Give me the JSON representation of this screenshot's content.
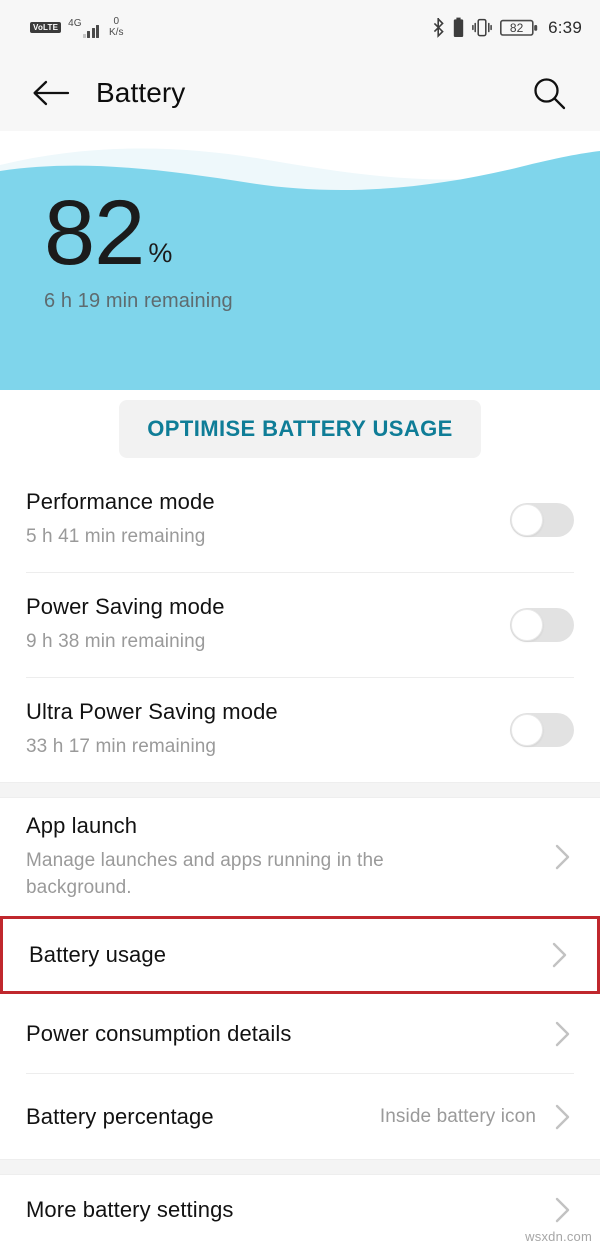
{
  "statusbar": {
    "volte_label": "VoLTE",
    "network_label": "4G",
    "netspeed_value": "0",
    "netspeed_unit": "K/s",
    "battery_level": "82",
    "time": "6:39",
    "icons": {
      "bluetooth": "bluetooth-icon",
      "battery_small": "battery-icon",
      "vibrate": "vibrate-icon",
      "battery_box": "battery-percentage-icon",
      "signal": "signal-bars-icon"
    }
  },
  "appbar": {
    "back_icon": "back-arrow-icon",
    "title": "Battery",
    "search_icon": "search-icon"
  },
  "hero": {
    "percent": "82",
    "percent_symbol": "%",
    "remaining": "6 h 19 min remaining",
    "wave_color": "#7fd5eb",
    "wave_back_color": "#eef8fb"
  },
  "optimise": {
    "label": "OPTIMISE BATTERY USAGE",
    "text_color": "#0f7d97"
  },
  "modes": [
    {
      "title": "Performance mode",
      "subtitle": "5 h 41 min remaining",
      "toggle_state": "off"
    },
    {
      "title": "Power Saving mode",
      "subtitle": "9 h 38 min remaining",
      "toggle_state": "off"
    },
    {
      "title": "Ultra Power Saving mode",
      "subtitle": "33 h 17 min remaining",
      "toggle_state": "off"
    }
  ],
  "settings": [
    {
      "title": "App launch",
      "subtitle": "Manage launches and apps running in the background.",
      "value": "",
      "highlighted": false
    },
    {
      "title": "Battery usage",
      "subtitle": "",
      "value": "",
      "highlighted": true
    },
    {
      "title": "Power consumption details",
      "subtitle": "",
      "value": "",
      "highlighted": false
    },
    {
      "title": "Battery percentage",
      "subtitle": "",
      "value": "Inside battery icon",
      "highlighted": false
    }
  ],
  "more": [
    {
      "title": "More battery settings",
      "subtitle": "",
      "value": ""
    }
  ],
  "highlight_color": "#c0272d",
  "watermark": "wsxdn.com"
}
